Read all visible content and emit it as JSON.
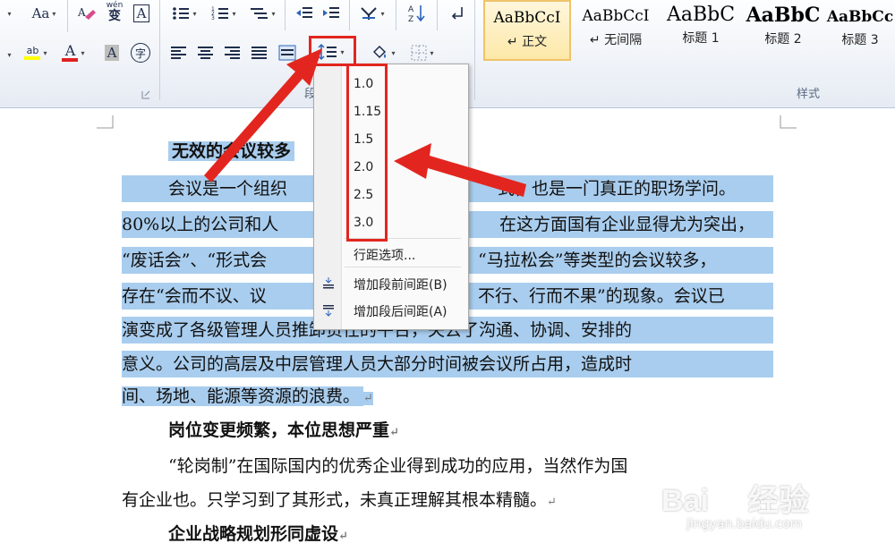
{
  "ribbon": {
    "font": {
      "font_size_label": "Aa",
      "pinyin_glyph": "wén",
      "char_border_glyph": "A",
      "highlight_glyph": "ab",
      "font_color_glyph": "A",
      "char_shading_glyph": "A",
      "enclose_glyph": "字"
    },
    "paragraph": {
      "group_label": "段落"
    },
    "styles": {
      "group_label": "样式",
      "items": [
        {
          "preview": "AaBbCcI",
          "name": "↵ 正文",
          "selected": true
        },
        {
          "preview": "AaBbCcI",
          "name": "↵ 无间隔",
          "selected": false
        },
        {
          "preview": "AaBbC",
          "name": "标题 1",
          "selected": false
        },
        {
          "preview": "AaBbC",
          "name": "标题 2",
          "selected": false
        },
        {
          "preview": "AaBbCc",
          "name": "标题 3",
          "selected": false
        }
      ]
    }
  },
  "line_spacing_menu": {
    "options": [
      "1.0",
      "1.15",
      "1.5",
      "2.0",
      "2.5",
      "3.0"
    ],
    "line_spacing_options": "行距选项...",
    "add_space_before": "增加段前间距(B)",
    "add_space_after": "增加段后间距(A)"
  },
  "document": {
    "lines": [
      {
        "text": "无效的会议较多",
        "indent": 52,
        "highlight": true,
        "bold": true,
        "mark": ""
      },
      {
        "text": "会议是一个组织",
        "tail": "式，也是一门真正的职场学问。",
        "indent": 52,
        "highlight": true,
        "bold": false
      },
      {
        "text": "80%以上的公司和人",
        "tail": "在这方面国有企业显得尤为突出，",
        "indent": 0,
        "highlight": true,
        "bold": false
      },
      {
        "text": "“废话会”、“形式会",
        "tail": "“马拉松会”等类型的会议较多，",
        "indent": 0,
        "highlight": true,
        "bold": false
      },
      {
        "text": "存在“会而不议、议",
        "tail": "不行、行而不果”的现象。会议已",
        "indent": 0,
        "highlight": true,
        "bold": false
      },
      {
        "text": "演变成了各级管理人员推卸责任的平台，失去了沟通、协调、安排的",
        "indent": 0,
        "highlight": true,
        "bold": false
      },
      {
        "text": "意义。公司的高层及中层管理人员大部分时间被会议所占用，造成时",
        "indent": 0,
        "highlight": true,
        "bold": false
      },
      {
        "text": "间、场地、能源等资源的浪费。",
        "indent": 0,
        "highlight": true,
        "bold": false,
        "mark": "↵"
      },
      {
        "text": "岗位变更频繁，本位思想严重",
        "indent": 52,
        "highlight": false,
        "bold": true,
        "mark": "↵"
      },
      {
        "text": "“轮岗制”在国际国内的优秀企业得到成功的应用，当然作为国",
        "indent": 52,
        "highlight": false,
        "bold": false
      },
      {
        "text": "有企业也。只学习到了其形式，未真正理解其根本精髓。",
        "indent": 0,
        "highlight": false,
        "bold": false,
        "mark": "↵"
      },
      {
        "text": "企业战略规划形同虚设",
        "indent": 52,
        "highlight": false,
        "bold": true,
        "mark": "↵"
      }
    ]
  },
  "watermark": {
    "brand": "Bai",
    "brand2": "经验",
    "url": "jingyan.baidu.com"
  },
  "colors": {
    "selection": "#a9cdee",
    "annotation_red": "#e2261f",
    "ribbon_top": "#fdfeff",
    "ribbon_bottom": "#e6ebf3"
  }
}
